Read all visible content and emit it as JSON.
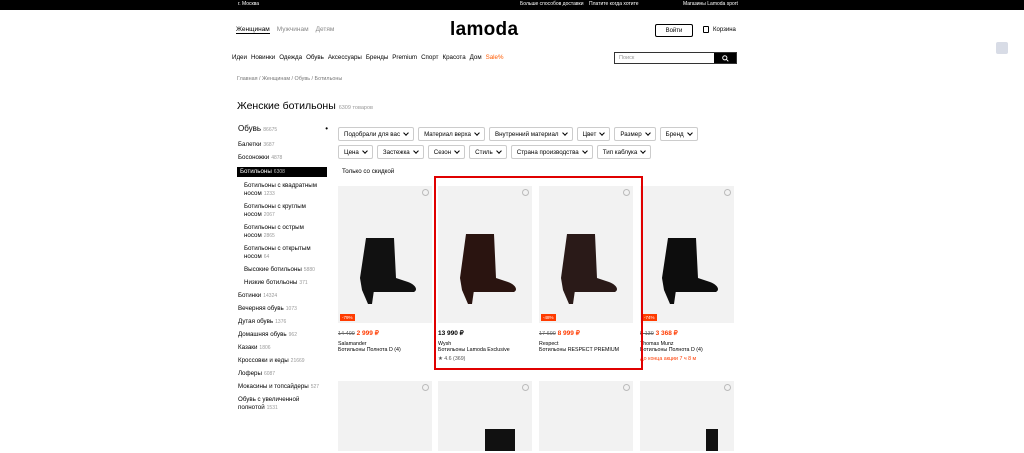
{
  "topbar": {
    "city": "г. Москва",
    "delivery": "Больше способов доставки",
    "payment": "Платите когда хотите",
    "stores": "Магазины Lamoda sport"
  },
  "header": {
    "tabs": [
      "Женщинам",
      "Мужчинам",
      "Детям"
    ],
    "logo": "lamoda",
    "login": "Войти",
    "cart": "Корзина"
  },
  "menu": [
    "Идеи",
    "Новинки",
    "Одежда",
    "Обувь",
    "Аксессуары",
    "Бренды",
    "Premium",
    "Спорт",
    "Красота",
    "Дом",
    "Sale%"
  ],
  "search": {
    "placeholder": "Поиск"
  },
  "breadcrumb": "Главная / Женщинам / Обувь / Ботильоны",
  "title": {
    "text": "Женские ботильоны",
    "count": "6309 товаров"
  },
  "sidebar": {
    "head": {
      "label": "Обувь",
      "count": "86675"
    },
    "items": [
      {
        "label": "Балетки",
        "count": "3687",
        "type": "normal"
      },
      {
        "label": "Босоножки",
        "count": "4878",
        "type": "normal"
      },
      {
        "label": "Ботильоны",
        "count": "6308",
        "type": "active"
      },
      {
        "label": "Ботильоны с квадратным носом",
        "count": "1233",
        "type": "sub"
      },
      {
        "label": "Ботильоны с круглым носом",
        "count": "2067",
        "type": "sub"
      },
      {
        "label": "Ботильоны с острым носом",
        "count": "2865",
        "type": "sub"
      },
      {
        "label": "Ботильоны с открытым носом",
        "count": "64",
        "type": "sub"
      },
      {
        "label": "Высокие ботильоны",
        "count": "5880",
        "type": "sub"
      },
      {
        "label": "Низкие ботильоны",
        "count": "371",
        "type": "sub"
      },
      {
        "label": "Ботинки",
        "count": "14324",
        "type": "normal"
      },
      {
        "label": "Вечерняя обувь",
        "count": "1073",
        "type": "normal"
      },
      {
        "label": "Дутая обувь",
        "count": "1376",
        "type": "normal"
      },
      {
        "label": "Домашняя обувь",
        "count": "962",
        "type": "normal"
      },
      {
        "label": "Казаки",
        "count": "1806",
        "type": "normal"
      },
      {
        "label": "Кроссовки и кеды",
        "count": "21669",
        "type": "normal"
      },
      {
        "label": "Лоферы",
        "count": "6087",
        "type": "normal"
      },
      {
        "label": "Мокасины и топсайдеры",
        "count": "527",
        "type": "normal"
      },
      {
        "label": "Обувь с увеличенной полнотой",
        "count": "1531",
        "type": "normal"
      }
    ]
  },
  "filters": [
    "Подобрали для вас",
    "Материал верха",
    "Внутренний материал",
    "Цвет",
    "Размер",
    "Бренд",
    "Цена",
    "Застежка",
    "Сезон",
    "Стиль",
    "Страна производства",
    "Тип каблука"
  ],
  "only_discount": "Только со скидкой",
  "products": [
    {
      "discount": "-79%",
      "old_price": "14 499",
      "new_price": "2 999 ₽",
      "brand": "Salamander",
      "name": "Ботильоны Полнота D (4)",
      "rating": "",
      "note": ""
    },
    {
      "discount": "",
      "old_price": "",
      "new_price": "13 990 ₽",
      "brand": "Wysh",
      "name": "Ботильоны Lamoda Exclusive",
      "rating": "★ 4.6 (369)",
      "note": ""
    },
    {
      "discount": "-48%",
      "old_price": "17 690",
      "new_price": "8 999 ₽",
      "brand": "Respect",
      "name": "Ботильоны RESPECT PREMIUM",
      "rating": "",
      "note": ""
    },
    {
      "discount": "-74%",
      "old_price": "5 139",
      "new_price": "3 368 ₽",
      "brand": "Thomas Munz",
      "name": "Ботильоны Полнота D (4)",
      "rating": "",
      "note": "До конца акции 7 ч 8 м"
    }
  ],
  "colors": {
    "accent": "#ff3b00",
    "highlight": "#e00000"
  }
}
